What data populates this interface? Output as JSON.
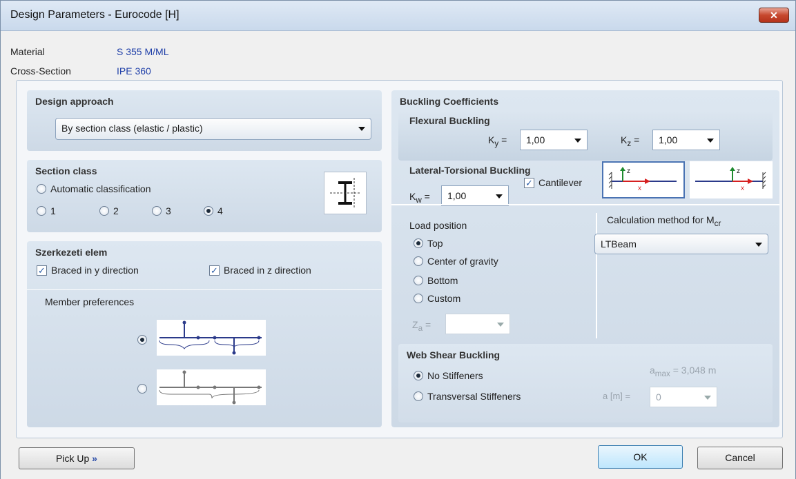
{
  "window": {
    "title": "Design Parameters - Eurocode [H]",
    "close_glyph": "✕"
  },
  "info": {
    "material_label": "Material",
    "material_value": "S 355 M/ML",
    "cross_label": "Cross-Section",
    "cross_value": "IPE 360"
  },
  "design_approach": {
    "title": "Design approach",
    "selected": "By section class (elastic / plastic)"
  },
  "section_class": {
    "title": "Section class",
    "automatic": "Automatic classification",
    "options": [
      "1",
      "2",
      "3",
      "4"
    ],
    "selected": "4"
  },
  "member": {
    "title": "Szerkezeti elem",
    "braced_y": "Braced in y direction",
    "braced_z": "Braced in z direction",
    "preferences": "Member preferences"
  },
  "buckling": {
    "title": "Buckling Coefficients",
    "flexural": {
      "title": "Flexural Buckling",
      "ky_label": "K",
      "ky_sub": "y",
      "kz_label": "K",
      "kz_sub": "z",
      "eq": "=",
      "ky": "1,00",
      "kz": "1,00"
    },
    "lateral": {
      "title": "Lateral-Torsional Buckling",
      "kw_label": "K",
      "kw_sub": "w",
      "eq": "=",
      "kw": "1,00",
      "cantilever": "Cantilever"
    },
    "load_position": {
      "title": "Load position",
      "options": [
        "Top",
        "Center of gravity",
        "Bottom",
        "Custom"
      ],
      "selected": "Top",
      "za_label": "Z",
      "za_sub": "a",
      "za_eq": "="
    },
    "calc_method": {
      "title_prefix": "Calculation method for M",
      "title_sub": "cr",
      "selected": "LTBeam"
    },
    "web_shear": {
      "title": "Web Shear Buckling",
      "no_stiff": "No Stiffeners",
      "trans_stiff": "Transversal Stiffeners",
      "amax_label": "a",
      "amax_sub": "max",
      "amax_value": " = 3,048 m",
      "a_label": "a [m] =",
      "a_value": "0"
    }
  },
  "buttons": {
    "pickup": "Pick Up",
    "pickup_glyph": "»",
    "ok": "OK",
    "cancel": "Cancel"
  }
}
